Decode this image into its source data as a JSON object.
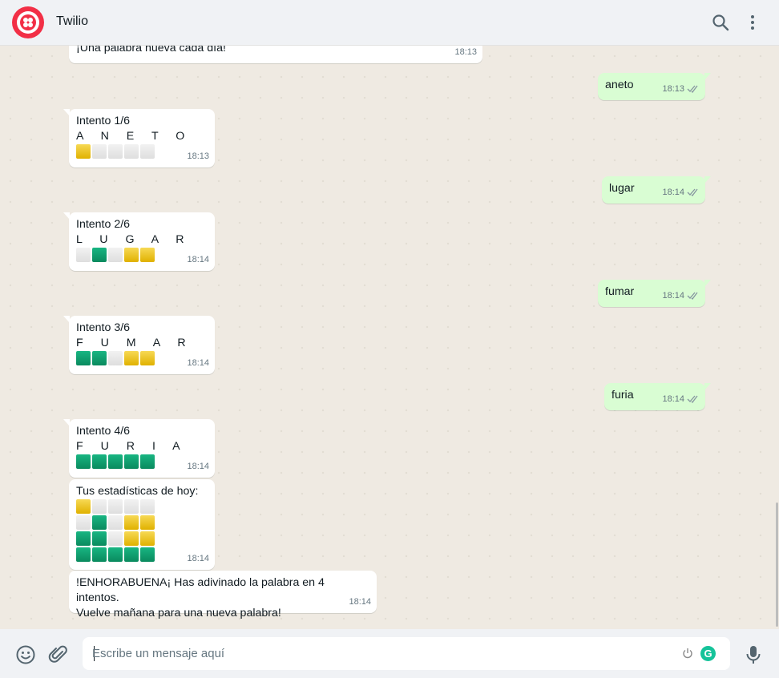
{
  "header": {
    "title": "Twilio",
    "logo_icon": "twilio-logo",
    "search_icon": "search-icon",
    "menu_icon": "kebab-menu-icon"
  },
  "messages": {
    "m0": {
      "text": "¡Una palabra nueva cada día!",
      "time": "18:13"
    },
    "o1": {
      "text": "aneto",
      "time": "18:13"
    },
    "i1": {
      "title": "Intento 1/6",
      "letters": "A N E T O",
      "row": [
        "y",
        "w",
        "w",
        "w",
        "w"
      ],
      "time": "18:13"
    },
    "o2": {
      "text": "lugar",
      "time": "18:14"
    },
    "i2": {
      "title": "Intento 2/6",
      "letters": "L U G A R",
      "row": [
        "w",
        "g",
        "w",
        "y",
        "y"
      ],
      "time": "18:14"
    },
    "o3": {
      "text": "fumar",
      "time": "18:14"
    },
    "i3": {
      "title": "Intento 3/6",
      "letters": "F U M A R",
      "row": [
        "g",
        "g",
        "w",
        "y",
        "y"
      ],
      "time": "18:14"
    },
    "o4": {
      "text": "furia",
      "time": "18:14"
    },
    "i4": {
      "title": "Intento 4/6",
      "letters": "F U R I A",
      "row": [
        "g",
        "g",
        "g",
        "g",
        "g"
      ],
      "time": "18:14"
    },
    "stats": {
      "title": "Tus estadísticas de hoy:",
      "time": "18:14"
    },
    "final": {
      "line1": "!ENHORABUENA¡ Has adivinado la palabra en 4 intentos.",
      "line2": "Vuelve mañana para una nueva palabra!",
      "time": "18:14"
    }
  },
  "footer": {
    "placeholder": "Escribe un mensaje aquí",
    "emoji_icon": "emoji-icon",
    "attach_icon": "paperclip-icon",
    "mic_icon": "microphone-icon",
    "grammarly_icon": "grammarly-icon",
    "power_icon": "power-icon"
  },
  "colors": {
    "green": "#0e9f6e",
    "yellow": "#f2c300",
    "gray": "#e6e6e6",
    "outgoing": "#d9fdd3",
    "brand": "#f22f46"
  }
}
